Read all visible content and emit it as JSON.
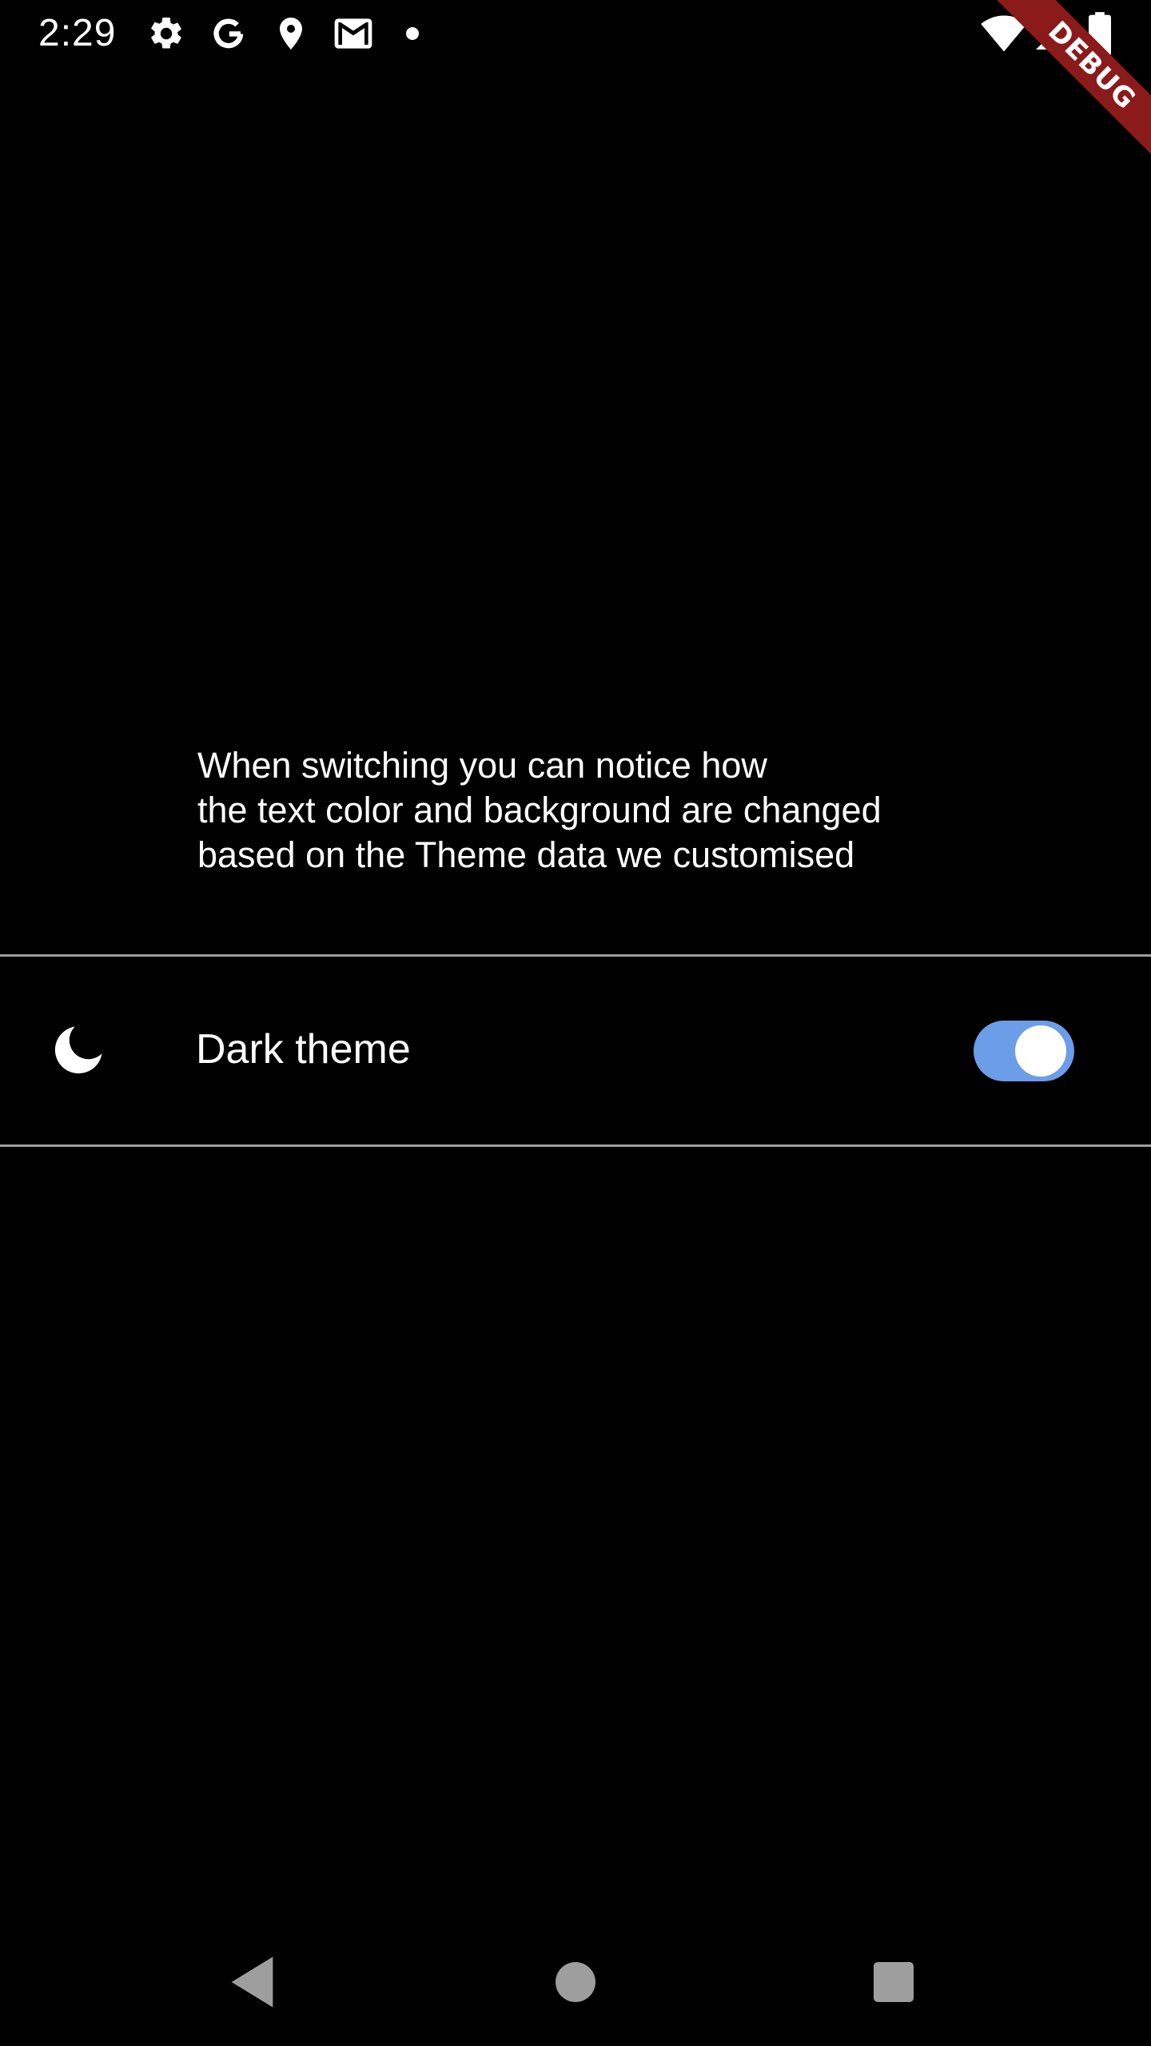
{
  "status_bar": {
    "time": "2:29",
    "left_icons": [
      "gear-icon",
      "google-g-icon",
      "location-pin-icon",
      "gmail-icon",
      "notification-dot-icon"
    ],
    "right_icons": [
      "wifi-icon",
      "cell-signal-icon",
      "battery-icon"
    ]
  },
  "debug_banner": {
    "label": "DEBUG",
    "color": "#8b1a1a"
  },
  "description": {
    "lines": [
      "When switching you can notice how",
      "the text color and background are changed",
      "based on the Theme data we customised"
    ]
  },
  "theme_setting": {
    "icon": "moon-icon",
    "label": "Dark theme",
    "enabled": true,
    "track_color": "#6b9de8"
  },
  "nav_bar": {
    "buttons": [
      "back-icon",
      "home-icon",
      "recents-icon"
    ]
  },
  "colors": {
    "background": "#000000",
    "text": "#ffffff",
    "divider": "#9e9e9e",
    "nav_icon": "#9e9e9e"
  }
}
